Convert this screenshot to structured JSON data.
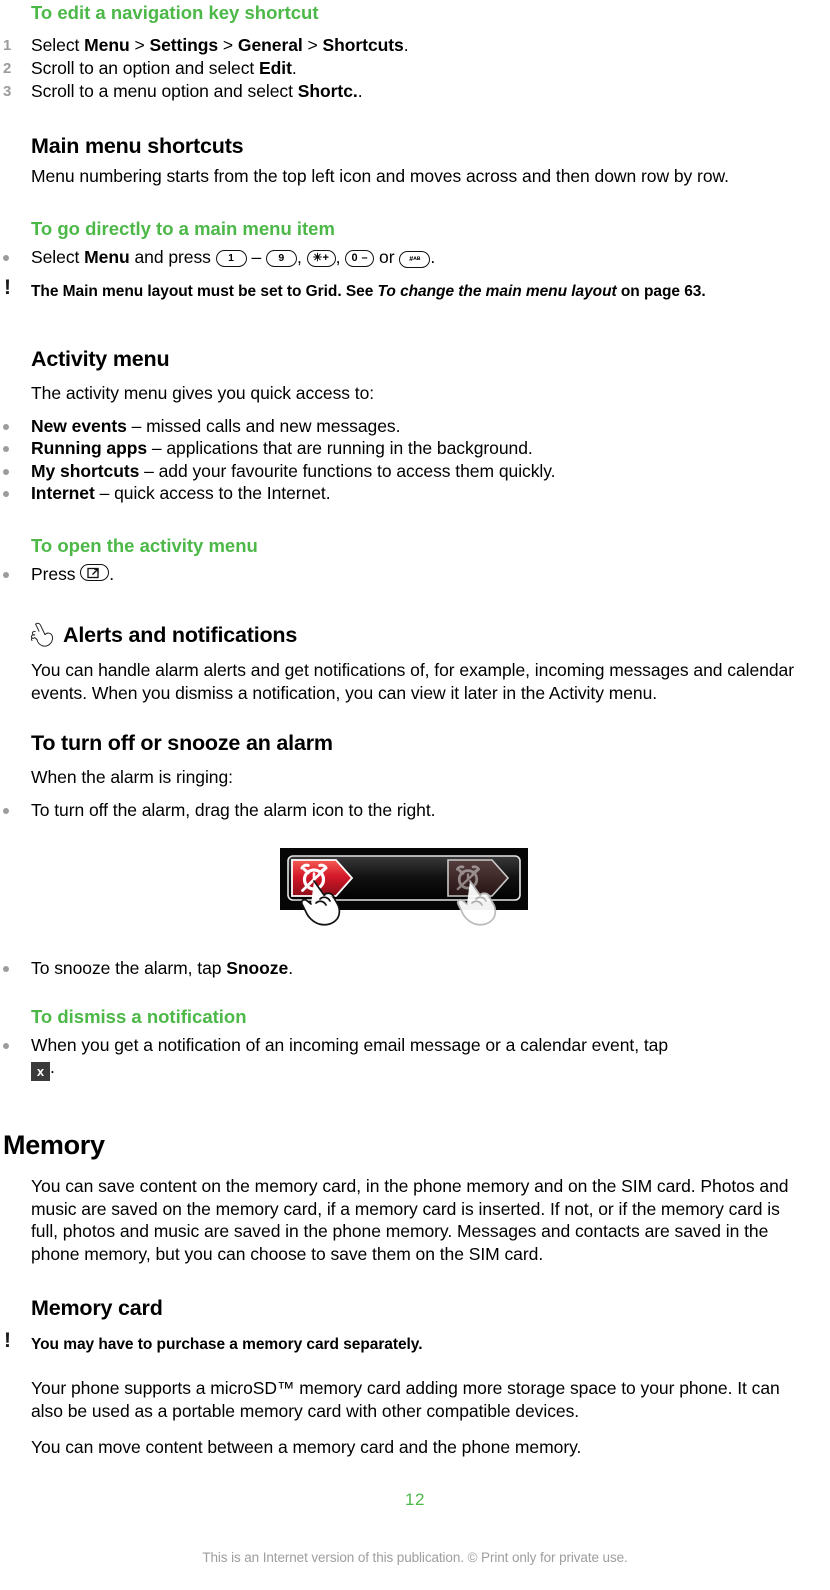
{
  "document": {
    "page_number": "12",
    "footer": "This is an Internet version of this publication. © Print only for private use.",
    "accent_green": "#4cb848",
    "muted_gray": "#9c9c9c"
  },
  "sections": {
    "edit_shortcut": {
      "heading": "To edit a navigation key shortcut",
      "steps": [
        {
          "num": "1",
          "prefix": "Select ",
          "b1": "Menu",
          "s1": " > ",
          "b2": "Settings",
          "s2": " > ",
          "b3": "General",
          "s3": " > ",
          "b4": "Shortcuts",
          "suffix": "."
        },
        {
          "num": "2",
          "prefix": "Scroll to an option and select ",
          "b1": "Edit",
          "suffix": "."
        },
        {
          "num": "3",
          "prefix": "Scroll to a menu option and select ",
          "b1": "Shortc.",
          "suffix": "."
        }
      ]
    },
    "main_menu_shortcuts": {
      "heading": "Main menu shortcuts",
      "body": "Menu numbering starts from the top left icon and moves across and then down row by row.",
      "sub_heading": "To go directly to a main menu item",
      "bullet_prefix": "Select ",
      "bullet_bold": "Menu",
      "bullet_mid": " and press ",
      "keys": {
        "one": "1",
        "dash": " – ",
        "nine": "9",
        "comma1": ", ",
        "star": "✳+",
        "comma2": ", ",
        "zero": "0 –",
        "or": " or ",
        "hash": "#",
        "hash_sup": "ᴀʙ",
        "end": "."
      },
      "note": {
        "p1": "The ",
        "b1": "Main menu layout",
        "p2": " must be set to ",
        "b2": "Grid",
        "p3": ". See ",
        "i1": "To change the main menu layout",
        "p4": " on page 63."
      }
    },
    "activity_menu": {
      "heading": "Activity menu",
      "body": "The activity menu gives you quick access to:",
      "items": [
        {
          "bold": "New events",
          "rest": " – missed calls and new messages."
        },
        {
          "bold": "Running apps",
          "rest": " – applications that are running in the background."
        },
        {
          "bold": "My shortcuts",
          "rest": " – add your favourite functions to access them quickly."
        },
        {
          "bold": "Internet",
          "rest": " – quick access to the Internet."
        }
      ],
      "sub_heading": "To open the activity menu",
      "press_prefix": "Press ",
      "press_key_icon": "activity-key-icon",
      "press_suffix": "."
    },
    "alerts": {
      "icon": "pointing-hand-icon",
      "heading": "Alerts and notifications",
      "body": "You can handle alarm alerts and get notifications of, for example, incoming messages and calendar events. When you dismiss a notification, you can view it later in the Activity menu.",
      "turn_off_heading": "To turn off or snooze an alarm",
      "turn_off_body": "When the alarm is ringing:",
      "bullet_drag": "To turn off the alarm, drag the alarm icon to the right.",
      "figure": {
        "name": "alarm-slider-illustration",
        "description": "Alarm slider with red alarm-clock arrow being dragged right by a hand"
      },
      "bullet_snooze_prefix": "To snooze the alarm, tap ",
      "bullet_snooze_bold": "Snooze",
      "bullet_snooze_suffix": ".",
      "dismiss_heading": "To dismiss a notification",
      "dismiss_body": "When you get a notification of an incoming email message or a calendar event, tap",
      "dismiss_icon_label": "x",
      "dismiss_suffix": "."
    },
    "memory": {
      "heading": "Memory",
      "body": "You can save content on the memory card, in the phone memory and on the SIM card. Photos and music are saved on the memory card, if a memory card is inserted. If not, or if the memory card is full, photos and music are saved in the phone memory. Messages and contacts are saved in the phone memory, but you can choose to save them on the SIM card.",
      "card_heading": "Memory card",
      "card_note": "You may have to purchase a memory card separately.",
      "card_body1": "Your phone supports a microSD™ memory card adding more storage space to your phone. It can also be used as a portable memory card with other compatible devices.",
      "card_body2": "You can move content between a memory card and the phone memory."
    }
  }
}
